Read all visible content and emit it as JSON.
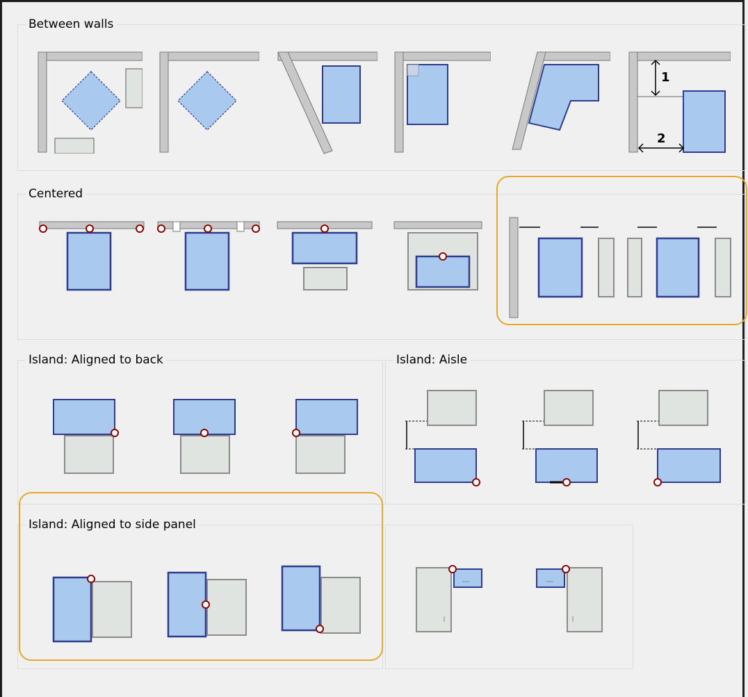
{
  "groups": {
    "between_walls": {
      "title": "Between walls",
      "dim_1": "1",
      "dim_2": "2"
    },
    "centered": {
      "title": "Centered"
    },
    "island_back": {
      "title": "Island: Aligned to back"
    },
    "island_aisle": {
      "title": "Island: Aisle"
    },
    "island_side": {
      "title": "Island: Aligned to side panel"
    }
  },
  "colors": {
    "module_fill": "#a9c9ef",
    "module_border": "#303a8a",
    "cabinet_fill": "#dfe4e0",
    "cabinet_border": "#8a8a8a",
    "wall_fill": "#c8c8c8",
    "anchor": "#8b0000",
    "highlight": "#e5a82a"
  }
}
